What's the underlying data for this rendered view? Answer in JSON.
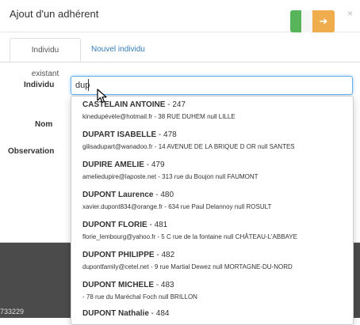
{
  "modal": {
    "title": "Ajout d'un adhérent",
    "close_glyph": "×",
    "toggle_icon": "toggle-flag-icon",
    "toggle_glyph": "➜"
  },
  "tabs": [
    {
      "label": "Individu existant",
      "active": true
    },
    {
      "label": "Nouvel individu",
      "active": false
    }
  ],
  "form": {
    "individu_label": "Individu",
    "individu_value": "dup",
    "nom_label": "Nom",
    "observation_label": "Observation"
  },
  "suggestions": [
    {
      "name": "CASTELAIN ANTOINE",
      "id": "247",
      "detail": "kinedupévèle@hotmail.fr - 38 RUE DUHEM null LILLE"
    },
    {
      "name": "DUPART ISABELLE",
      "id": "478",
      "detail": "gilisadupart@wanadoo.fr - 14 AVENUE DE LA BRIQUE D OR null SANTES"
    },
    {
      "name": "DUPIRE AMELIE",
      "id": "479",
      "detail": "ameliedupire@laposte.net - 313 rue du Boujon null FAUMONT"
    },
    {
      "name": "DUPONT Laurence",
      "id": "480",
      "detail": "xavier.dupont834@orange.fr - 634 rue Paul Delannoy null ROSULT"
    },
    {
      "name": "DUPONT FLORIE",
      "id": "481",
      "detail": "florie_lembourg@yahoo.fr - 5 C rue de la fontaine null CHÂTEAU-L'ABBAYE"
    },
    {
      "name": "DUPONT PHILIPPE",
      "id": "482",
      "detail": "dupontfamily@cetel.net - 9 rue Martial Dewez null MORTAGNE-DU-NORD"
    },
    {
      "name": "DUPONT MICHELE",
      "id": "483",
      "detail": "- 78 rue du Maréchal Foch null BRILLON"
    },
    {
      "name": "DUPONT Nathalie",
      "id": "484",
      "detail": ""
    }
  ],
  "background": {
    "footer_number": "733229"
  },
  "colors": {
    "toggle_green": "#58b45a",
    "toggle_orange": "#f0ad4e",
    "link_blue": "#337ab7",
    "focus_border": "#66afe9"
  }
}
